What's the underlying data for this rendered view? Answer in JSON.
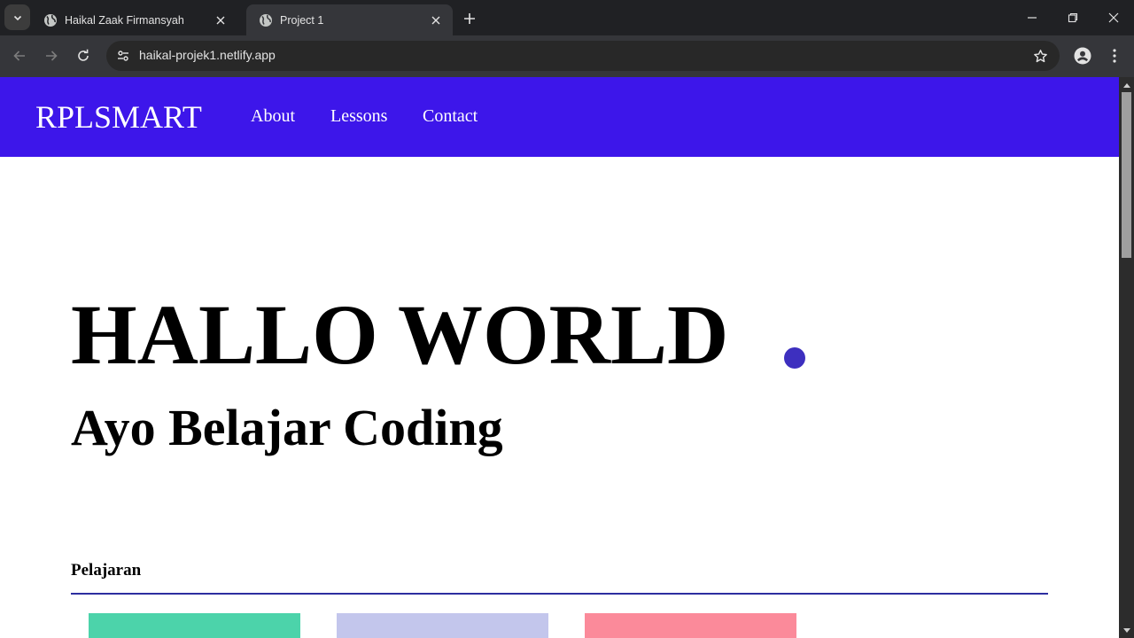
{
  "browser": {
    "tabs": [
      {
        "title": "Haikal Zaak Firmansyah",
        "active": false
      },
      {
        "title": "Project 1",
        "active": true
      }
    ],
    "url": "haikal-projek1.netlify.app",
    "icons": {
      "tab_search": "chevron-down-icon",
      "favicon": "globe-icon",
      "close": "close-icon",
      "new_tab": "plus-icon",
      "back": "arrow-left-icon",
      "forward": "arrow-right-icon",
      "reload": "reload-icon",
      "site_info": "tune-icon",
      "bookmark": "star-icon",
      "profile": "person-icon",
      "menu": "more-vertical-icon",
      "minimize": "minimize-icon",
      "restore": "restore-icon",
      "window_close": "close-icon"
    }
  },
  "site": {
    "brand": "RPLSMART",
    "nav": [
      {
        "label": "About"
      },
      {
        "label": "Lessons"
      },
      {
        "label": "Contact"
      }
    ],
    "hero": {
      "title": "HALLO WORLD",
      "subtitle": "Ayo Belajar Coding"
    },
    "section": {
      "title": "Pelajaran"
    },
    "colors": {
      "header_bg": "#3d16ea",
      "accent_dot": "#3d2fbf",
      "divider": "#2c2ea0",
      "card_1": "#4cd3aa",
      "card_2": "#c3c6ec",
      "card_3": "#fb8a9a"
    }
  }
}
